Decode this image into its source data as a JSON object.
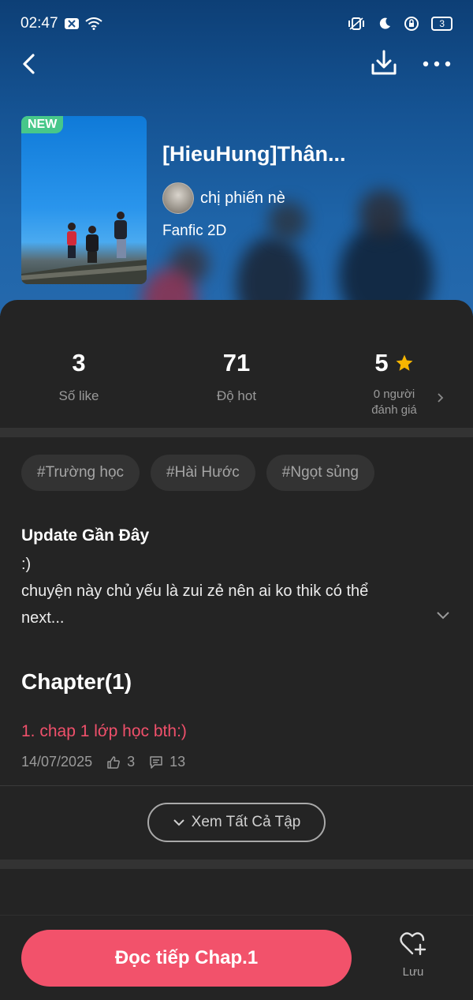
{
  "status_bar": {
    "time": "02:47",
    "battery": "3"
  },
  "story": {
    "badge": "NEW",
    "title": "[HieuHung]Thân...",
    "author": "chị phiến nè",
    "genre": "Fanfic 2D"
  },
  "stats": [
    {
      "value": "3",
      "label": "Số like"
    },
    {
      "value": "71",
      "label": "Độ hot"
    },
    {
      "value": "5",
      "label_line1": "0 người",
      "label_line2": "đánh giá"
    }
  ],
  "tags": [
    "#Trường học",
    "#Hài Hước",
    "#Ngọt sủng"
  ],
  "update": {
    "title": "Update Gần Đây",
    "line1": ":)",
    "line2": "chuyện này chủ yếu là zui zẻ nên ai ko thik có thể",
    "line3": "next..."
  },
  "chapters": {
    "heading": "Chapter(1)",
    "items": [
      {
        "title": "1. chap 1 lớp học bth:)",
        "date": "14/07/2025",
        "likes": "3",
        "comments": "13"
      }
    ],
    "see_all": "Xem Tất Cả Tập"
  },
  "bottom": {
    "read_button": "Đọc tiếp Chap.1",
    "save_label": "Lưu"
  },
  "colors": {
    "accent": "#f2526b",
    "chapter_link": "#f0506b",
    "star": "#f7b500",
    "new_badge": "#47c78a"
  }
}
